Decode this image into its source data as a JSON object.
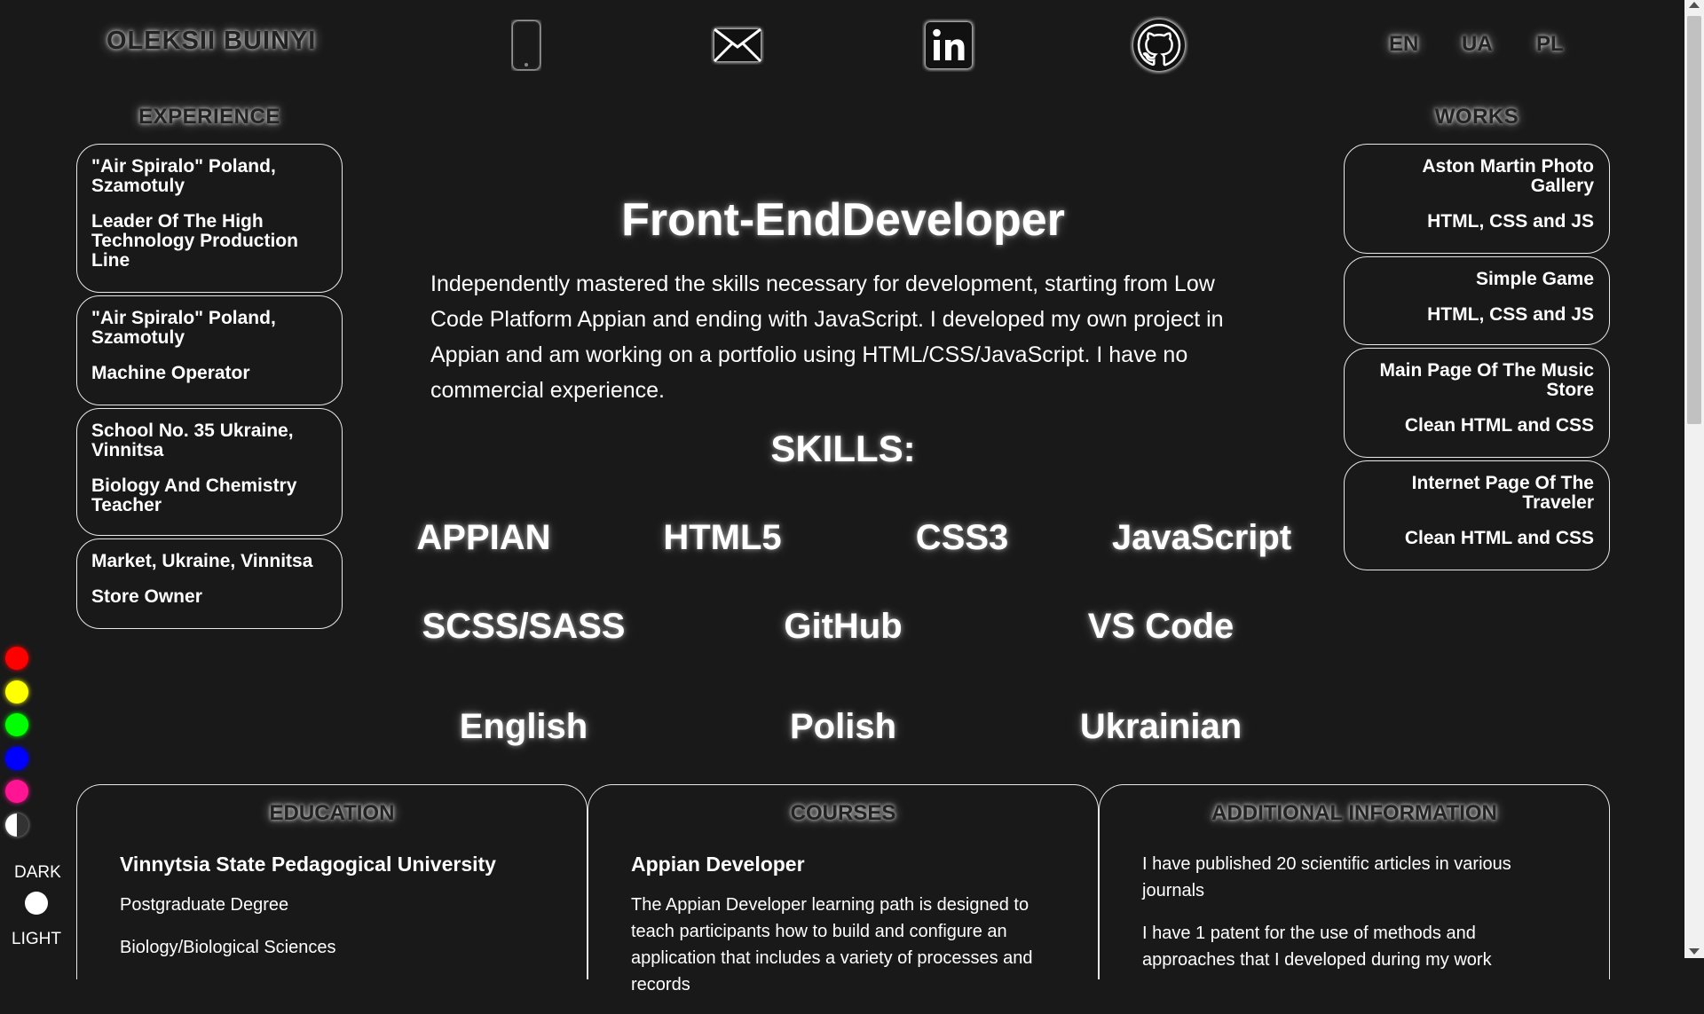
{
  "header": {
    "name": "OLEKSII BUINYI",
    "contacts": [
      {
        "icon": "phone-icon"
      },
      {
        "icon": "mail-icon"
      },
      {
        "icon": "linkedin-icon"
      },
      {
        "icon": "github-icon"
      }
    ],
    "languages": [
      "EN",
      "UA",
      "PL"
    ]
  },
  "experience": {
    "heading": "EXPERIENCE",
    "items": [
      {
        "place": "\"Air Spiralo\" Poland, Szamotuly",
        "role": "Leader Of The High Technology Production Line"
      },
      {
        "place": "\"Air Spiralo\" Poland, Szamotuly",
        "role": "Machine Operator"
      },
      {
        "place": "School No. 35 Ukraine, Vinnitsa",
        "role": "Biology And Chemistry Teacher"
      },
      {
        "place": "Market, Ukraine, Vinnitsa",
        "role": "Store Owner"
      }
    ]
  },
  "works": {
    "heading": "WORKS",
    "items": [
      {
        "title": "Aston Martin Photo Gallery",
        "tech": "HTML, CSS and JS"
      },
      {
        "title": "Simple Game",
        "tech": "HTML, CSS and JS"
      },
      {
        "title": "Main Page Of The Music Store",
        "tech": "Clean HTML and CSS"
      },
      {
        "title": "Internet Page Of The Traveler",
        "tech": "Clean HTML and CSS"
      }
    ]
  },
  "main": {
    "title": "Front-EndDeveloper",
    "about": "Independently mastered the skills necessary for development, starting from Low Code Platform Appian and ending with JavaScript. I developed my own project in Appian and am working on a portfolio using HTML/CSS/JavaScript. I have no commercial experience.",
    "skills_heading": "SKILLS:",
    "skills_row1": [
      "APPIAN",
      "HTML5",
      "CSS3",
      "JavaScript"
    ],
    "skills_row2": [
      "SCSS/SASS",
      "GitHub",
      "VS Code"
    ],
    "languages_row": [
      "English",
      "Polish",
      "Ukrainian"
    ]
  },
  "theme": {
    "swatches": [
      "#ff0000",
      "#ffff00",
      "#00ff00",
      "#0000ff",
      "#ff1493"
    ],
    "dark_label": "DARK",
    "light_label": "LIGHT"
  },
  "education": {
    "heading": "EDUCATION",
    "school": "Vinnytsia State Pedagogical University",
    "degree": "Postgraduate Degree",
    "field": "Biology/Biological Sciences"
  },
  "courses": {
    "heading": "COURSES",
    "name": "Appian Developer",
    "desc": "The Appian Developer learning path is designed to teach participants how to build and configure an application that includes a variety of processes and records"
  },
  "additional": {
    "heading": "ADDITIONAL INFORMATION",
    "line1": "I have published 20 scientific articles in various journals",
    "line2": "I have 1 patent for the use of methods and approaches that I developed during my work"
  }
}
